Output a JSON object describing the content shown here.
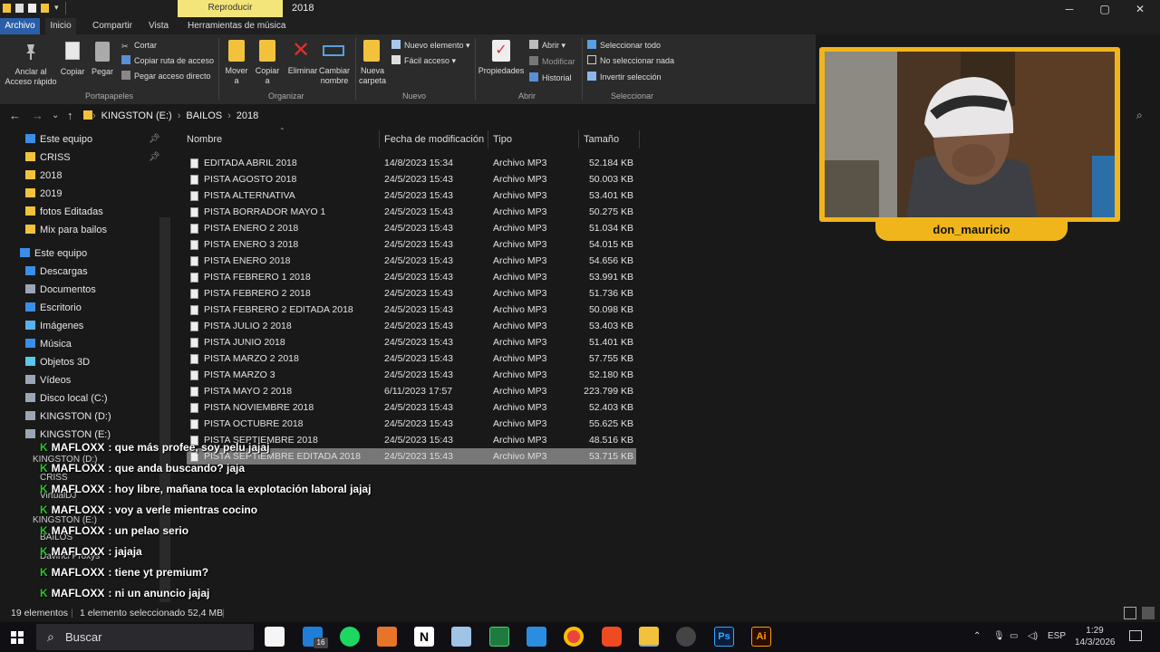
{
  "titlebar": {
    "context_tab": "Reproducir",
    "title": "2018"
  },
  "window_controls": {
    "minimize": "─",
    "maximize": "▢",
    "close": "✕"
  },
  "tabs": [
    "Archivo",
    "Inicio",
    "Compartir",
    "Vista",
    "Herramientas de música"
  ],
  "ribbon": {
    "pin_label_1": "Anclar al",
    "pin_label_2": "Acceso rápido",
    "copy": "Copiar",
    "paste": "Pegar",
    "cut": "Cortar",
    "copy_path": "Copiar ruta de acceso",
    "paste_shortcut": "Pegar acceso directo",
    "group_clipboard": "Portapapeles",
    "move_1": "Mover",
    "move_2": "a",
    "copyto_1": "Copiar",
    "copyto_2": "a",
    "delete": "Eliminar",
    "rename_1": "Cambiar",
    "rename_2": "nombre",
    "group_organize": "Organizar",
    "newfolder_1": "Nueva",
    "newfolder_2": "carpeta",
    "new_item": "Nuevo elemento",
    "easy_access": "Fácil acceso",
    "group_new": "Nuevo",
    "properties": "Propiedades",
    "open": "Abrir",
    "modify": "Modificar",
    "history": "Historial",
    "group_open": "Abrir",
    "select_all": "Seleccionar todo",
    "select_none": "No seleccionar nada",
    "invert": "Invertir selección",
    "group_select": "Seleccionar"
  },
  "address": {
    "crumbs": [
      "KINGSTON (E:)",
      "BAILOS",
      "2018"
    ]
  },
  "nav": [
    {
      "label": "Este equipo",
      "color": "#3a8ee6"
    },
    {
      "label": "CRISS",
      "color": "#f3c23d"
    },
    {
      "label": "2018",
      "color": "#f3c23d"
    },
    {
      "label": "2019",
      "color": "#f3c23d"
    },
    {
      "label": "fotos Editadas",
      "color": "#f3c23d"
    },
    {
      "label": "Mix para bailos",
      "color": "#f3c23d"
    },
    {
      "label": "Este equipo",
      "color": "#3a8ee6"
    },
    {
      "label": "Descargas",
      "color": "#3a8ee6"
    },
    {
      "label": "Documentos",
      "color": "#9aa6b5"
    },
    {
      "label": "Escritorio",
      "color": "#3a8ee6"
    },
    {
      "label": "Imágenes",
      "color": "#5ab0e8"
    },
    {
      "label": "Música",
      "color": "#3a8ee6"
    },
    {
      "label": "Objetos 3D",
      "color": "#5ac8e8"
    },
    {
      "label": "Vídeos",
      "color": "#9aa6b5"
    },
    {
      "label": "Disco local (C:)",
      "color": "#9aa6b5"
    },
    {
      "label": "KINGSTON (D:)",
      "color": "#9aa6b5"
    },
    {
      "label": "KINGSTON (E:)",
      "color": "#9aa6b5"
    }
  ],
  "nav_ghost": [
    "KINGSTON (D:)",
    "CRISS",
    "VirtualDJ",
    "KINGSTON (E:)",
    "BAILOS",
    "Davinci Proxys"
  ],
  "columns": {
    "name": "Nombre",
    "modified": "Fecha de modificación",
    "type": "Tipo",
    "size": "Tamaño"
  },
  "files": [
    {
      "name": "EDITADA ABRIL 2018",
      "date": "14/8/2023 15:34",
      "type": "Archivo MP3",
      "size": "52.184 KB"
    },
    {
      "name": "PISTA AGOSTO 2018",
      "date": "24/5/2023 15:43",
      "type": "Archivo MP3",
      "size": "50.003 KB"
    },
    {
      "name": "PISTA ALTERNATIVA",
      "date": "24/5/2023 15:43",
      "type": "Archivo MP3",
      "size": "53.401 KB"
    },
    {
      "name": "PISTA BORRADOR MAYO 1",
      "date": "24/5/2023 15:43",
      "type": "Archivo MP3",
      "size": "50.275 KB"
    },
    {
      "name": "PISTA ENERO 2 2018",
      "date": "24/5/2023 15:43",
      "type": "Archivo MP3",
      "size": "51.034 KB"
    },
    {
      "name": "PISTA ENERO 3 2018",
      "date": "24/5/2023 15:43",
      "type": "Archivo MP3",
      "size": "54.015 KB"
    },
    {
      "name": "PISTA ENERO 2018",
      "date": "24/5/2023 15:43",
      "type": "Archivo MP3",
      "size": "54.656 KB"
    },
    {
      "name": "PISTA FEBRERO 1 2018",
      "date": "24/5/2023 15:43",
      "type": "Archivo MP3",
      "size": "53.991 KB"
    },
    {
      "name": "PISTA FEBRERO 2 2018",
      "date": "24/5/2023 15:43",
      "type": "Archivo MP3",
      "size": "51.736 KB"
    },
    {
      "name": "PISTA FEBRERO 2 EDITADA 2018",
      "date": "24/5/2023 15:43",
      "type": "Archivo MP3",
      "size": "50.098 KB"
    },
    {
      "name": "PISTA JULIO 2 2018",
      "date": "24/5/2023 15:43",
      "type": "Archivo MP3",
      "size": "53.403 KB"
    },
    {
      "name": "PISTA JUNIO 2018",
      "date": "24/5/2023 15:43",
      "type": "Archivo MP3",
      "size": "51.401 KB"
    },
    {
      "name": "PISTA MARZO 2 2018",
      "date": "24/5/2023 15:43",
      "type": "Archivo MP3",
      "size": "57.755 KB"
    },
    {
      "name": "PISTA MARZO 3",
      "date": "24/5/2023 15:43",
      "type": "Archivo MP3",
      "size": "52.180 KB"
    },
    {
      "name": "PISTA MAYO 2 2018",
      "date": "6/11/2023 17:57",
      "type": "Archivo MP3",
      "size": "223.799 KB"
    },
    {
      "name": "PISTA NOVIEMBRE 2018",
      "date": "24/5/2023 15:43",
      "type": "Archivo MP3",
      "size": "52.403 KB"
    },
    {
      "name": "PISTA OCTUBRE 2018",
      "date": "24/5/2023 15:43",
      "type": "Archivo MP3",
      "size": "55.625 KB"
    },
    {
      "name": "PISTA SEPTIEMBRE 2018",
      "date": "24/5/2023 15:43",
      "type": "Archivo MP3",
      "size": "48.516 KB"
    },
    {
      "name": "PISTA SEPTIEMBRE EDITADA 2018",
      "date": "24/5/2023 15:43",
      "type": "Archivo MP3",
      "size": "53.715 KB",
      "selected": true
    }
  ],
  "chat": [
    {
      "user": "MAFLOXX",
      "msg": ": que más profee, soy pelu jajaj"
    },
    {
      "user": "MAFLOXX",
      "msg": ": que anda buscando? jaja"
    },
    {
      "user": "MAFLOXX",
      "msg": ": hoy libre, mañana toca la explotación laboral jajaj"
    },
    {
      "user": "MAFLOXX",
      "msg": ": voy a verle mientras cocino"
    },
    {
      "user": "MAFLOXX",
      "msg": ": un pelao serio"
    },
    {
      "user": "MAFLOXX",
      "msg": ": jajaja"
    },
    {
      "user": "MAFLOXX",
      "msg": ": tiene yt premium?"
    },
    {
      "user": "MAFLOXX",
      "msg": ": ni un anuncio jajaj"
    }
  ],
  "webcam": {
    "name": "don_mauricio"
  },
  "status": {
    "count": "19 elementos",
    "selection": "1 elemento seleccionado  52,4 MB"
  },
  "taskbar": {
    "search": "Buscar",
    "badge": "16",
    "lang": "ESP",
    "time": "1:29",
    "date": "14/3/2026"
  },
  "colors": {
    "accent": "#2a5fa8",
    "folder": "#f3c23d",
    "chat_user": "#28c828",
    "cam_frame": "#f0b51b"
  }
}
